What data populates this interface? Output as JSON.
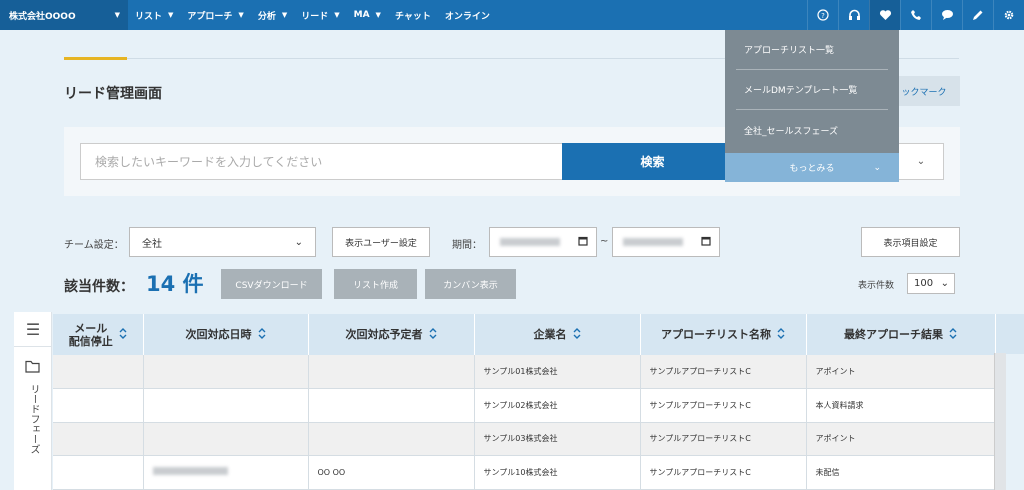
{
  "nav": {
    "company": "株式会社OOOO",
    "items": [
      "リスト",
      "アプローチ",
      "分析",
      "リード",
      "MA",
      "チャット",
      "オンライン"
    ],
    "items_with_caret": [
      true,
      true,
      true,
      true,
      true,
      false,
      false
    ],
    "icons": [
      "help-icon",
      "headset-icon",
      "heart-icon",
      "phone-icon",
      "chat-bubble-icon",
      "pencil-icon",
      "gear-icon"
    ],
    "active_icon": "heart-icon",
    "colors": {
      "bar": "#1b70b2",
      "active": "#165f98"
    }
  },
  "page": {
    "title": "リード管理画面",
    "bookmark": "ックマーク"
  },
  "search": {
    "placeholder": "検索したいキーワードを入力してください",
    "button": "検索"
  },
  "dropdown": {
    "items": [
      "アプローチリスト一覧",
      "メールDMテンプレート一覧",
      "全社_セールスフェーズ"
    ],
    "more": "もっとみる"
  },
  "filters": {
    "team_label": "チーム設定：",
    "team_value": "全社",
    "user_settings_button": "表示ユーザー設定",
    "period_label": "期間：",
    "tilde": "~",
    "display_items_button": "表示項目設定"
  },
  "results": {
    "count_label": "該当件数：",
    "count_value": "14 件",
    "csv_button": "CSVダウンロード",
    "list_button": "リスト作成",
    "kanban_button": "カンバン表示",
    "per_page_label": "表示件数",
    "per_page_value": "100"
  },
  "side": {
    "label": "リードフェーズ"
  },
  "table": {
    "headers": [
      "メール\n配信停止",
      "次回対応日時",
      "次回対応予定者",
      "企業名",
      "アプローチリスト名称",
      "最終アプローチ結果"
    ],
    "rows": [
      {
        "mail": "",
        "next_date": "",
        "assignee": "",
        "company": "サンプル01株式会社",
        "list": "サンプルアプローチリストC",
        "result": "アポイント"
      },
      {
        "mail": "",
        "next_date": "",
        "assignee": "",
        "company": "サンプル02株式会社",
        "list": "サンプルアプローチリストC",
        "result": "本人資料請求"
      },
      {
        "mail": "",
        "next_date": "",
        "assignee": "",
        "company": "サンプル03株式会社",
        "list": "サンプルアプローチリストC",
        "result": "アポイント"
      },
      {
        "mail": "",
        "next_date": "",
        "assignee": "OO OO",
        "company": "サンプル10株式会社",
        "list": "サンプルアプローチリストC",
        "result": "未配信"
      }
    ]
  }
}
